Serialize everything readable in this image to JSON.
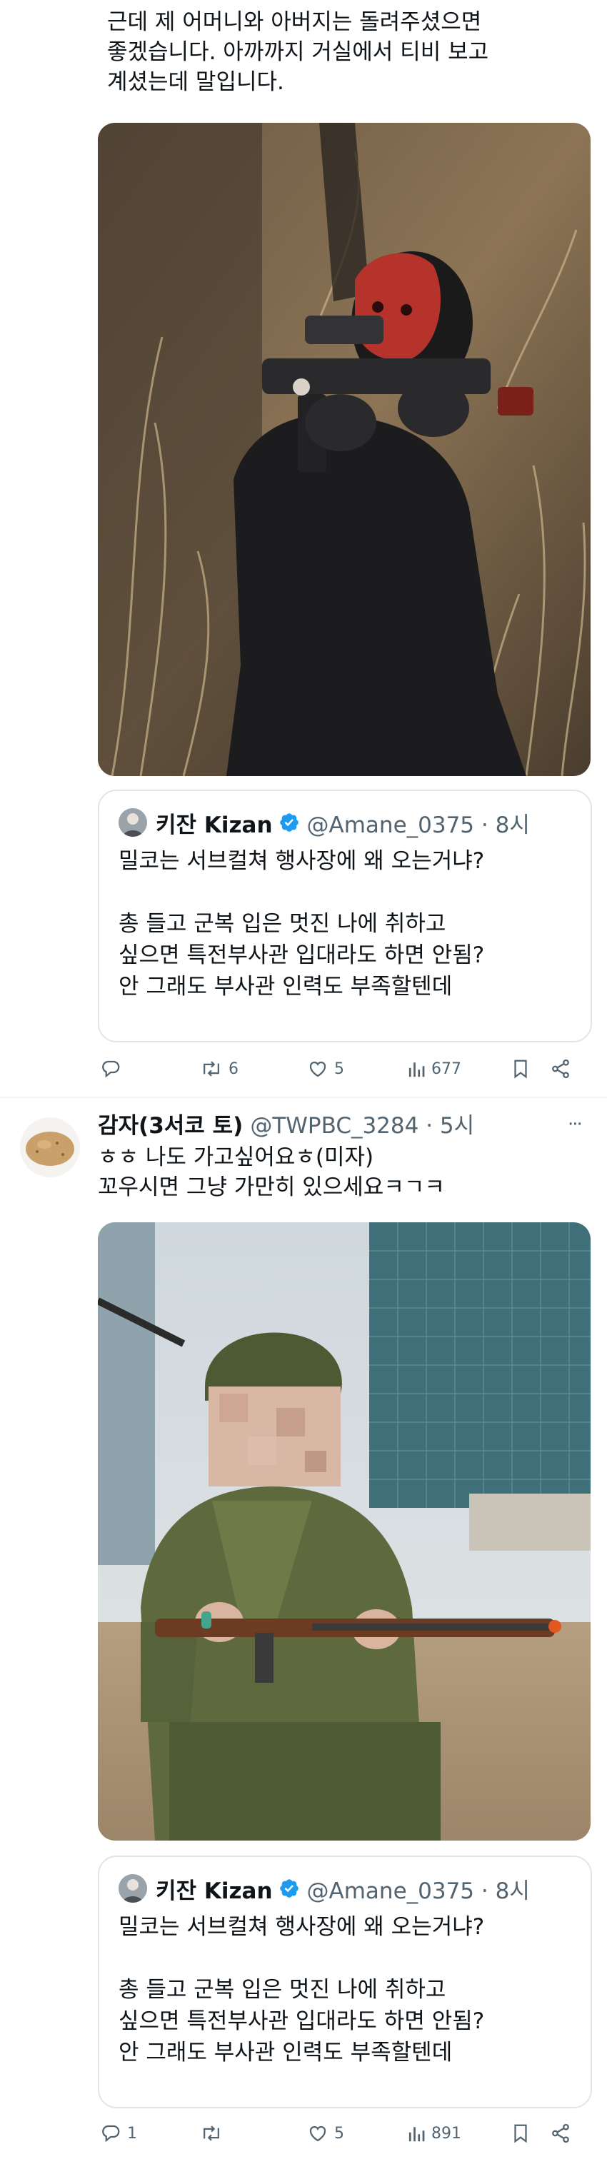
{
  "tweet1": {
    "text_lines": [
      "근데 제 어머니와 아버지는 돌려주셨으면",
      "좋겠습니다. 아까까지 거실에서 티비 보고",
      "계셨는데 말입니다."
    ],
    "quote": {
      "name": "키잔 Kizan",
      "handle": "@Amane_0375 · 8시",
      "body": "밀코는 서브컬쳐 행사장에 왜 오는거냐?\n\n총 들고 군복 입은 멋진 나에 취하고\n싶으면 특전부사관 입대라도 하면 안됨?\n안 그래도 부사관 인력도 부족할텐데"
    },
    "actions": {
      "replies": "",
      "reposts": "6",
      "likes": "5",
      "views": "677"
    }
  },
  "tweet2": {
    "name": "감자(3서코 토)",
    "handle": "@TWPBC_3284 · 5시",
    "more": "···",
    "text_lines": [
      "ㅎㅎ 나도 가고싶어요ㅎ(미자)",
      "꼬우시면 그냥 가만히 있으세요ㅋㄱㅋ"
    ],
    "quote": {
      "name": "키잔 Kizan",
      "handle": "@Amane_0375 · 8시",
      "body": "밀코는 서브컬쳐 행사장에 왜 오는거냐?\n\n총 들고 군복 입은 멋진 나에 취하고\n싶으면 특전부사관 입대라도 하면 안됨?\n안 그래도 부사관 인력도 부족할텐데"
    },
    "actions": {
      "replies": "1",
      "reposts": "",
      "likes": "5",
      "views": "891"
    }
  },
  "colors": {
    "verified": "#1d9bf0",
    "muted": "#536471",
    "text": "#0f1419",
    "border": "#e1e5e8"
  },
  "icons": [
    "reply-icon",
    "repost-icon",
    "like-icon",
    "views-icon",
    "bookmark-icon",
    "share-icon",
    "verified-icon",
    "more-icon"
  ]
}
